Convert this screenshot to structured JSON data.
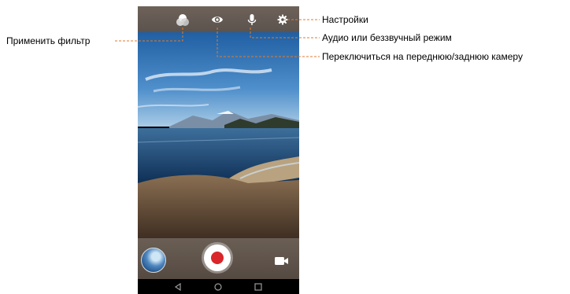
{
  "annotations": {
    "settings": "Настройки",
    "audio": "Аудио или беззвучный режим",
    "switch_camera": "Переключиться на переднюю/заднюю камеру",
    "filter": "Применить фильтр"
  },
  "colors": {
    "leader_line": "#e07a2e",
    "record_button": "#d9262a"
  },
  "icons": {
    "top_bar": [
      "filter-icon",
      "switch-camera-icon",
      "microphone-icon",
      "settings-gear-icon"
    ],
    "bottom_bar": [
      "gallery-thumbnail",
      "record-button",
      "video-mode-icon"
    ],
    "nav_bar": [
      "back-icon",
      "home-icon",
      "recents-icon"
    ]
  }
}
